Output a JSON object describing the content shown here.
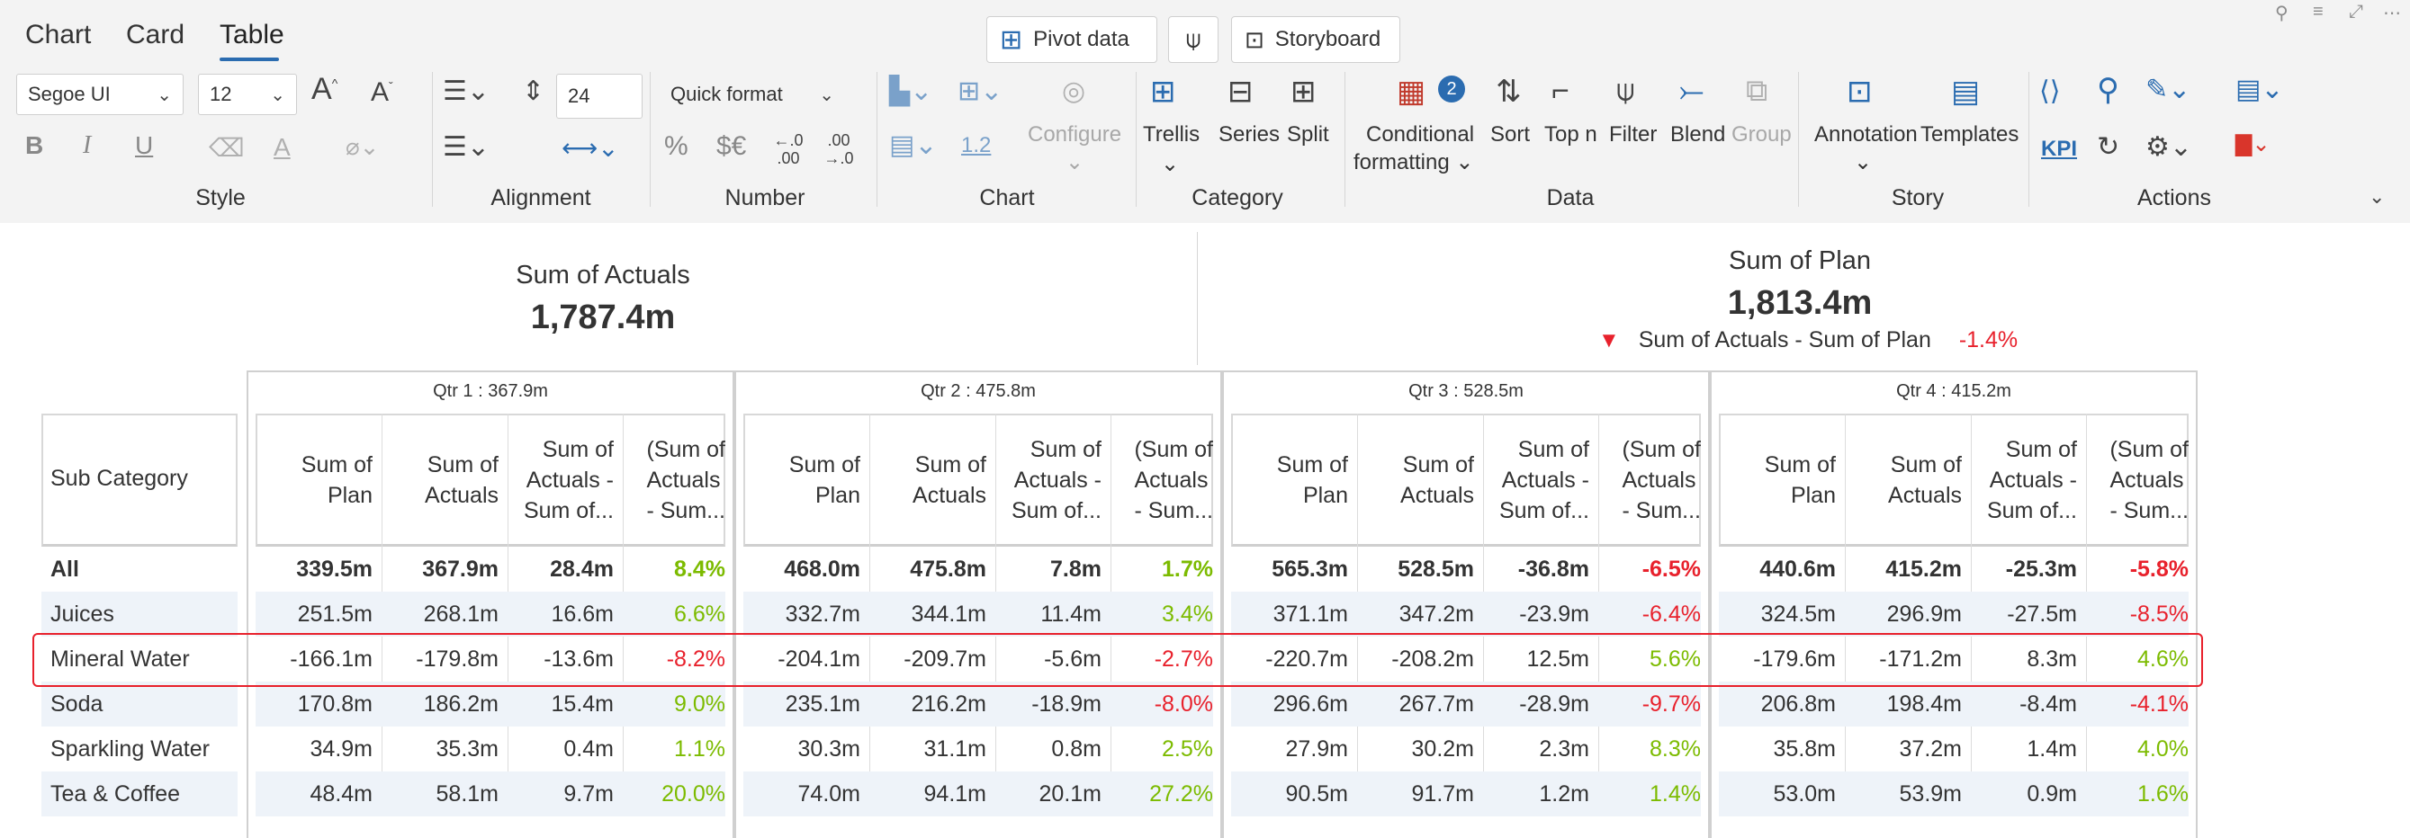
{
  "tabs": [
    {
      "label": "Chart",
      "active": false
    },
    {
      "label": "Card",
      "active": false
    },
    {
      "label": "Table",
      "active": true
    }
  ],
  "top_buttons": {
    "pivot": "Pivot data",
    "storyboard": "Storyboard"
  },
  "style": {
    "font_family": "Segoe UI",
    "font_size": "12",
    "bold": "B",
    "italic": "I",
    "underline": "U",
    "font_color_icon": "A",
    "label": "Style"
  },
  "alignment": {
    "line_height": "24",
    "label": "Alignment"
  },
  "number": {
    "quick_format": "Quick format",
    "percent": "%",
    "currency": "$€",
    "dec_inc": "←.0 .00",
    "dec_dec": ".00 →.0",
    "label": "Number"
  },
  "chart_group": {
    "configure": "Configure",
    "scale": "1.2",
    "label": "Chart"
  },
  "category": {
    "trellis": "Trellis",
    "series": "Series",
    "split": "Split",
    "label": "Category"
  },
  "data_group": {
    "conditional": "Conditional",
    "formatting": "formatting",
    "badge_count": "2",
    "sort": "Sort",
    "topn": "Top n",
    "filter": "Filter",
    "blend": "Blend",
    "group": "Group",
    "label": "Data"
  },
  "story": {
    "annotation": "Annotation",
    "templates": "Templates",
    "label": "Story"
  },
  "actions": {
    "kpi": "KPI",
    "label": "Actions"
  },
  "kpi_cards": {
    "actuals": {
      "title": "Sum of Actuals",
      "value": "1,787.4m"
    },
    "plan": {
      "title": "Sum of Plan",
      "value": "1,813.4m",
      "variance_label": "Sum of Actuals - Sum of Plan",
      "variance_value": "-1.4%"
    }
  },
  "table": {
    "row_header": "Sub Category",
    "column_headers": {
      "plan": [
        "Sum of",
        "Plan"
      ],
      "actuals": [
        "Sum of",
        "Actuals"
      ],
      "variance": [
        "Sum of",
        "Actuals -",
        "Sum of..."
      ],
      "variance_pct": [
        "(Sum of",
        "Actuals",
        "- Sum..."
      ]
    },
    "quarters": [
      {
        "title": "Qtr 1 :  367.9m"
      },
      {
        "title": "Qtr 2 :  475.8m"
      },
      {
        "title": "Qtr 3 :  528.5m"
      },
      {
        "title": "Qtr 4 :  415.2m"
      }
    ],
    "rows": [
      {
        "label": "All",
        "bold": true,
        "values": [
          [
            "339.5m",
            "367.9m",
            "28.4m",
            "8.4%"
          ],
          [
            "468.0m",
            "475.8m",
            "7.8m",
            "1.7%"
          ],
          [
            "565.3m",
            "528.5m",
            "-36.8m",
            "-6.5%"
          ],
          [
            "440.6m",
            "415.2m",
            "-25.3m",
            "-5.8%"
          ]
        ]
      },
      {
        "label": "Juices",
        "bold": false,
        "values": [
          [
            "251.5m",
            "268.1m",
            "16.6m",
            "6.6%"
          ],
          [
            "332.7m",
            "344.1m",
            "11.4m",
            "3.4%"
          ],
          [
            "371.1m",
            "347.2m",
            "-23.9m",
            "-6.4%"
          ],
          [
            "324.5m",
            "296.9m",
            "-27.5m",
            "-8.5%"
          ]
        ]
      },
      {
        "label": "Mineral Water",
        "bold": false,
        "values": [
          [
            "-166.1m",
            "-179.8m",
            "-13.6m",
            "-8.2%"
          ],
          [
            "-204.1m",
            "-209.7m",
            "-5.6m",
            "-2.7%"
          ],
          [
            "-220.7m",
            "-208.2m",
            "12.5m",
            "5.6%"
          ],
          [
            "-179.6m",
            "-171.2m",
            "8.3m",
            "4.6%"
          ]
        ]
      },
      {
        "label": "Soda",
        "bold": false,
        "values": [
          [
            "170.8m",
            "186.2m",
            "15.4m",
            "9.0%"
          ],
          [
            "235.1m",
            "216.2m",
            "-18.9m",
            "-8.0%"
          ],
          [
            "296.6m",
            "267.7m",
            "-28.9m",
            "-9.7%"
          ],
          [
            "206.8m",
            "198.4m",
            "-8.4m",
            "-4.1%"
          ]
        ]
      },
      {
        "label": "Sparkling Water",
        "bold": false,
        "values": [
          [
            "34.9m",
            "35.3m",
            "0.4m",
            "1.1%"
          ],
          [
            "30.3m",
            "31.1m",
            "0.8m",
            "2.5%"
          ],
          [
            "27.9m",
            "30.2m",
            "2.3m",
            "8.3%"
          ],
          [
            "35.8m",
            "37.2m",
            "1.4m",
            "4.0%"
          ]
        ]
      },
      {
        "label": "Tea & Coffee",
        "bold": false,
        "values": [
          [
            "48.4m",
            "58.1m",
            "9.7m",
            "20.0%"
          ],
          [
            "74.0m",
            "94.1m",
            "20.1m",
            "27.2%"
          ],
          [
            "90.5m",
            "91.7m",
            "1.2m",
            "1.4%"
          ],
          [
            "53.0m",
            "53.9m",
            "0.9m",
            "1.6%"
          ]
        ]
      }
    ]
  },
  "colors": {
    "accent": "#2b6cb0",
    "negative": "#e8212c",
    "positive": "#7cbb00",
    "band": "#eef3f9",
    "highlight": "#e8212c"
  },
  "icons": [
    "pin-icon",
    "filter-icon",
    "expand-icon",
    "more-icon",
    "pivot-icon",
    "filter-pin-icon",
    "storyboard-icon",
    "grow-font-icon",
    "shrink-font-icon",
    "align-icon",
    "line-height-icon",
    "highlight-icon",
    "font-color-icon",
    "visibility-icon",
    "bar-chart-icon",
    "trellis-icon",
    "series-icon",
    "split-icon",
    "conditional-formatting-icon",
    "sort-icon",
    "topn-icon",
    "filter-icon",
    "blend-icon",
    "group-icon",
    "annotation-icon",
    "templates-icon",
    "link-icon",
    "search-icon",
    "paint-icon",
    "settings-icon",
    "export-icon",
    "pdf-icon",
    "refresh-icon",
    "kpi-icon",
    "down-triangle-icon"
  ]
}
